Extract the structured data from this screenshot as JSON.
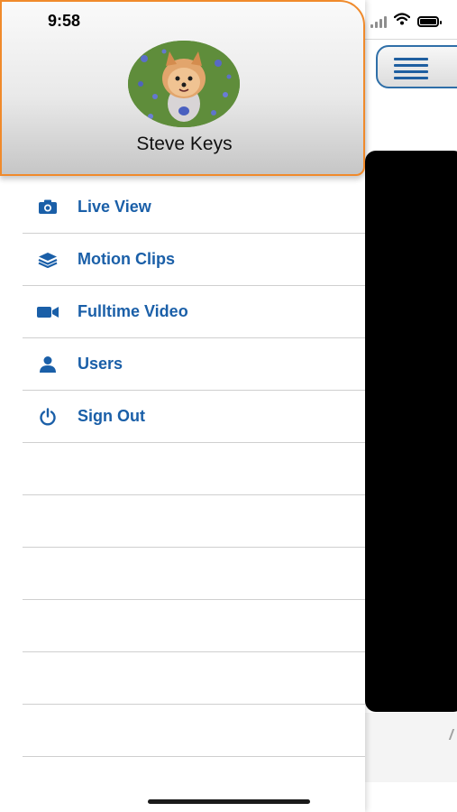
{
  "status_bar": {
    "time": "9:58"
  },
  "profile": {
    "name": "Steve Keys"
  },
  "menu": {
    "items": [
      {
        "label": "Live View",
        "icon": "camera-icon"
      },
      {
        "label": "Motion Clips",
        "icon": "layers-icon"
      },
      {
        "label": "Fulltime Video",
        "icon": "video-camera-icon"
      },
      {
        "label": "Users",
        "icon": "user-icon"
      },
      {
        "label": "Sign Out",
        "icon": "power-icon"
      }
    ]
  },
  "colors": {
    "accent_blue": "#1a5fa8",
    "header_border_orange": "#f08a2b"
  }
}
